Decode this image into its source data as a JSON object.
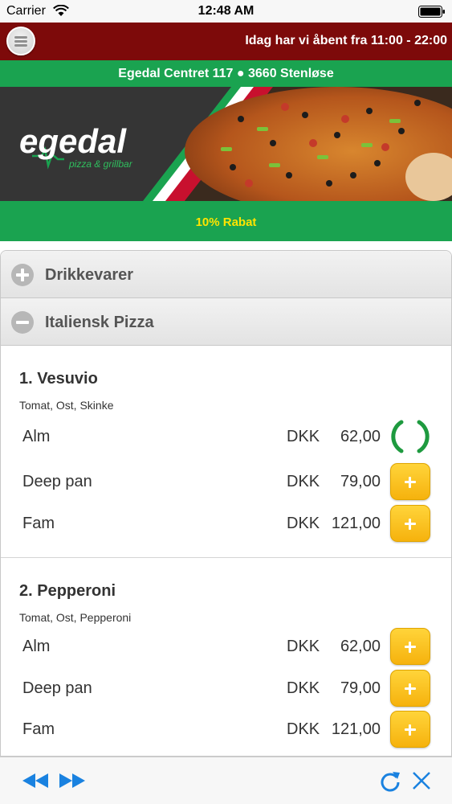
{
  "status_bar": {
    "carrier": "Carrier",
    "time": "12:48 AM"
  },
  "header": {
    "opening_hours": "Idag har vi åbent fra 11:00 - 22:00"
  },
  "address": "Egedal Centret 117 ● 3660 Stenløse",
  "banner": {
    "logo_text": "egedal",
    "logo_subtitle": "pizza & grillbar"
  },
  "discount": "10% Rabat",
  "categories": [
    {
      "label": "Drikkevarer",
      "state": "collapsed"
    },
    {
      "label": "Italiensk Pizza",
      "state": "expanded"
    }
  ],
  "products": [
    {
      "name": "1. Vesuvio",
      "description": "Tomat, Ost, Skinke",
      "variants": [
        {
          "name": "Alm",
          "currency": "DKK",
          "price": "62,00",
          "action": "loading"
        },
        {
          "name": "Deep pan",
          "currency": "DKK",
          "price": "79,00",
          "action": "add"
        },
        {
          "name": "Fam",
          "currency": "DKK",
          "price": "121,00",
          "action": "add"
        }
      ]
    },
    {
      "name": "2. Pepperoni",
      "description": "Tomat, Ost, Pepperoni",
      "variants": [
        {
          "name": "Alm",
          "currency": "DKK",
          "price": "62,00",
          "action": "add"
        },
        {
          "name": "Deep pan",
          "currency": "DKK",
          "price": "79,00",
          "action": "add"
        },
        {
          "name": "Fam",
          "currency": "DKK",
          "price": "121,00",
          "action": "add"
        }
      ]
    }
  ],
  "toolbar": {
    "icons": [
      "back-icon",
      "forward-icon",
      "reload-icon",
      "close-icon"
    ]
  },
  "colors": {
    "header_red": "#7d0a0a",
    "brand_green": "#1aa350",
    "discount_yellow": "#ffe400",
    "add_button_yellow": "#f6b20d",
    "toolbar_blue": "#1a82e0"
  }
}
